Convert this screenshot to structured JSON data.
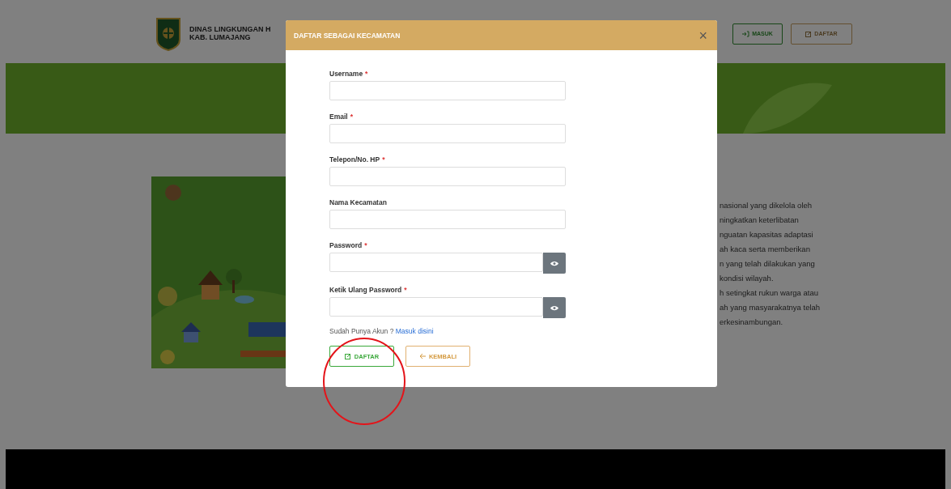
{
  "header": {
    "org_line_1": "DINAS LINGKUNGAN H",
    "org_line_2": "KAB. LUMAJANG",
    "buttons": [
      {
        "label": "MASUK",
        "kind": "login"
      },
      {
        "label": "DAFTAR",
        "kind": "register"
      }
    ]
  },
  "background_text": [
    "nasional yang dikelola oleh",
    "ningkatkan keterlibatan",
    "nguatan kapasitas adaptasi",
    "ah kaca serta memberikan",
    "n yang telah dilakukan yang",
    "kondisi wilayah.",
    "h setingkat rukun warga atau",
    "ah yang masyarakatnya telah",
    "erkesinambungan."
  ],
  "modal": {
    "title": "DAFTAR SEBAGAI KECAMATAN",
    "close": "×",
    "required_mark": "*",
    "fields": [
      {
        "label": "Username",
        "required": true,
        "kind": "text"
      },
      {
        "label": "Email",
        "required": true,
        "kind": "text"
      },
      {
        "label": "Telepon/No. HP",
        "required": true,
        "kind": "text"
      },
      {
        "label": "Nama Kecamatan",
        "required": false,
        "kind": "text"
      },
      {
        "label": "Password",
        "required": true,
        "kind": "password"
      },
      {
        "label": "Ketik Ulang Password",
        "required": true,
        "kind": "password"
      }
    ],
    "login_prompt": "Sudah Punya Akun ?",
    "login_link": "Masuk disini",
    "buttons": [
      {
        "label": "DAFTAR",
        "kind": "submit"
      },
      {
        "label": "KEMBALI",
        "kind": "back"
      }
    ]
  },
  "annotation": {
    "kind": "circle"
  }
}
